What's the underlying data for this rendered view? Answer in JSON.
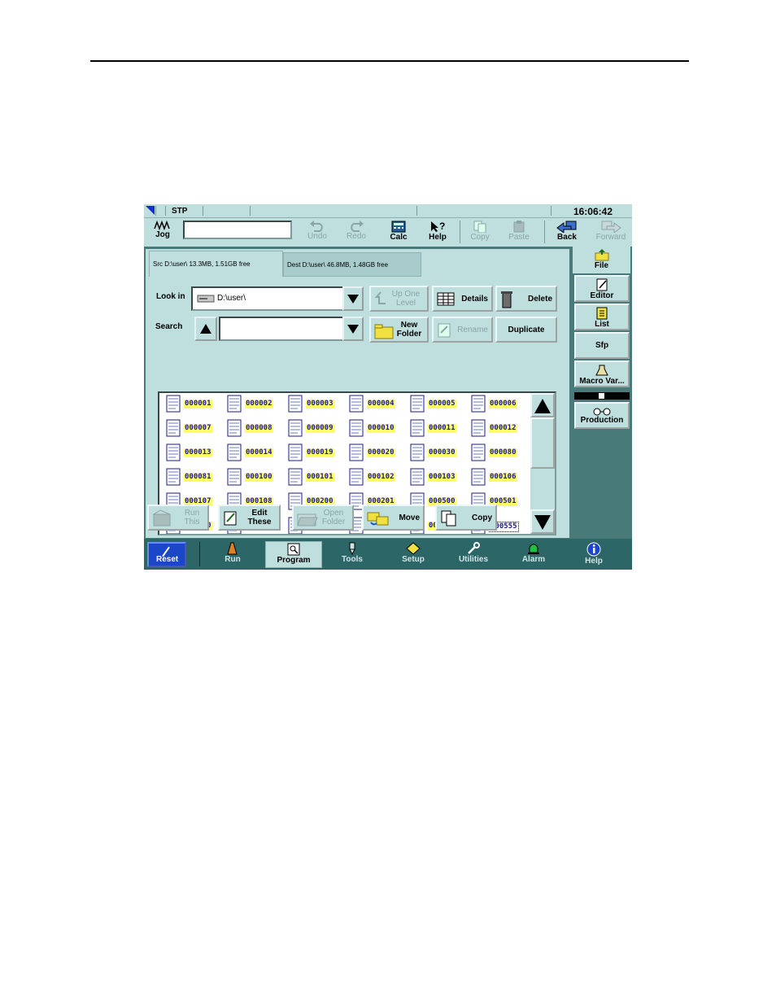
{
  "status": {
    "mode": "STP",
    "clock": "16:06:42"
  },
  "toolbar": {
    "jog": "Jog",
    "undo": "Undo",
    "redo": "Redo",
    "calc": "Calc",
    "help": "Help",
    "copy": "Copy",
    "paste": "Paste",
    "back": "Back",
    "forward": "Forward",
    "mdi_value": ""
  },
  "tabs": {
    "src": "Src D:\\user\\    13.3MB, 1.51GB free",
    "dest": "Dest D:\\user\\    46.8MB, 1.48GB free"
  },
  "look_in": {
    "label": "Look in",
    "value": "D:\\user\\"
  },
  "search": {
    "label": "Search",
    "value": ""
  },
  "buttons": {
    "up_one_level": "Up One Level",
    "details": "Details",
    "delete": "Delete",
    "new_folder": "New Folder",
    "rename": "Rename",
    "duplicate": "Duplicate",
    "run_this": "Run This",
    "edit_these": "Edit These",
    "open_folder": "Open Folder",
    "move": "Move",
    "copy": "Copy"
  },
  "files": [
    "000001",
    "000002",
    "000003",
    "000004",
    "000005",
    "000006",
    "000007",
    "000008",
    "000009",
    "000010",
    "000011",
    "000012",
    "000013",
    "000014",
    "000019",
    "000020",
    "000030",
    "000080",
    "000081",
    "000100",
    "000101",
    "000102",
    "000103",
    "000106",
    "000107",
    "000108",
    "000200",
    "000201",
    "000500",
    "000501",
    "000510",
    "000511",
    "000512",
    "000513",
    "000514",
    "000555"
  ],
  "selected_file": "000555",
  "side_panel": {
    "file": "File",
    "editor": "Editor",
    "list": "List",
    "sfp": "Sfp",
    "macro": "Macro Var...",
    "production": "Production"
  },
  "nav": {
    "reset": "Reset",
    "run": "Run",
    "program": "Program",
    "tools": "Tools",
    "setup": "Setup",
    "utilities": "Utilities",
    "alarm": "Alarm",
    "help": "Help"
  },
  "colors": {
    "panel": "#bfdede",
    "frame": "#497a7a",
    "nav": "#2d6666",
    "reset": "#1c46c8",
    "filename_highlight": "#ffff66"
  }
}
